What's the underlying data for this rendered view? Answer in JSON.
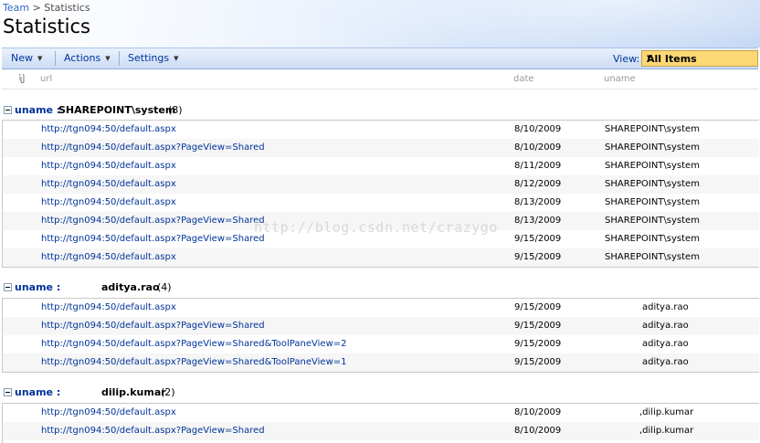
{
  "breadcrumb": {
    "parent": "Team",
    "separator": ">",
    "current": "Statistics"
  },
  "page_title": "Statistics",
  "toolbar": {
    "new_label": "New",
    "actions_label": "Actions",
    "settings_label": "Settings",
    "view_label": "View:",
    "view_value": "All Items"
  },
  "columns": {
    "url": "url",
    "date": "date",
    "uname": "uname"
  },
  "watermark": "http://blog.csdn.net/crazygo",
  "groups": [
    {
      "key": "uname :",
      "value": "SHAREPOINT\\system",
      "count": "(8)",
      "rows": [
        {
          "url": "http://tgn094:50/default.aspx",
          "date": "8/10/2009",
          "uname": "SHAREPOINT\\system"
        },
        {
          "url": "http://tgn094:50/default.aspx?PageView=Shared",
          "date": "8/10/2009",
          "uname": "SHAREPOINT\\system"
        },
        {
          "url": "http://tgn094:50/default.aspx",
          "date": "8/11/2009",
          "uname": "SHAREPOINT\\system"
        },
        {
          "url": "http://tgn094:50/default.aspx",
          "date": "8/12/2009",
          "uname": "SHAREPOINT\\system"
        },
        {
          "url": "http://tgn094:50/default.aspx",
          "date": "8/13/2009",
          "uname": "SHAREPOINT\\system"
        },
        {
          "url": "http://tgn094:50/default.aspx?PageView=Shared",
          "date": "8/13/2009",
          "uname": "SHAREPOINT\\system"
        },
        {
          "url": "http://tgn094:50/default.aspx?PageView=Shared",
          "date": "9/15/2009",
          "uname": "SHAREPOINT\\system"
        },
        {
          "url": "http://tgn094:50/default.aspx",
          "date": "9/15/2009",
          "uname": "SHAREPOINT\\system"
        }
      ]
    },
    {
      "key": "uname :",
      "value": "aditya.rao",
      "count": "(4)",
      "rows": [
        {
          "url": "http://tgn094:50/default.aspx",
          "date": "9/15/2009",
          "uname": "aditya.rao"
        },
        {
          "url": "http://tgn094:50/default.aspx?PageView=Shared",
          "date": "9/15/2009",
          "uname": "aditya.rao"
        },
        {
          "url": "http://tgn094:50/default.aspx?PageView=Shared&ToolPaneView=2",
          "date": "9/15/2009",
          "uname": "aditya.rao"
        },
        {
          "url": "http://tgn094:50/default.aspx?PageView=Shared&ToolPaneView=1",
          "date": "9/15/2009",
          "uname": "aditya.rao"
        }
      ]
    },
    {
      "key": "uname :",
      "value": "dilip.kumar",
      "count": "(2)",
      "rows": [
        {
          "url": "http://tgn094:50/default.aspx",
          "date": "8/10/2009",
          "uname": ",dilip.kumar"
        },
        {
          "url": "http://tgn094:50/default.aspx?PageView=Shared",
          "date": "8/10/2009",
          "uname": ",dilip.kumar"
        }
      ]
    }
  ]
}
